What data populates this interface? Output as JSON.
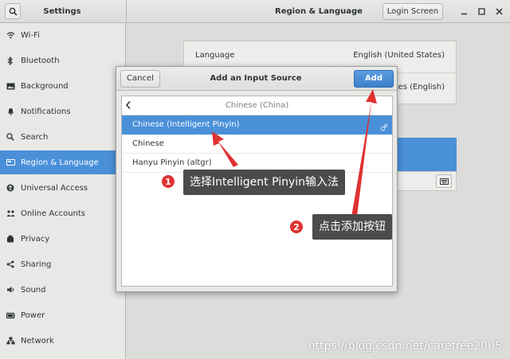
{
  "header": {
    "left_title": "Settings",
    "right_title": "Region & Language",
    "login_button": "Login Screen"
  },
  "sidebar": {
    "items": [
      {
        "label": "Wi-Fi",
        "icon": "wifi-icon"
      },
      {
        "label": "Bluetooth",
        "icon": "bluetooth-icon"
      },
      {
        "label": "Background",
        "icon": "background-icon"
      },
      {
        "label": "Notifications",
        "icon": "bell-icon"
      },
      {
        "label": "Search",
        "icon": "search-icon"
      },
      {
        "label": "Region & Language",
        "icon": "flag-icon",
        "active": true
      },
      {
        "label": "Universal Access",
        "icon": "accessibility-icon"
      },
      {
        "label": "Online Accounts",
        "icon": "accounts-icon"
      },
      {
        "label": "Privacy",
        "icon": "privacy-icon"
      },
      {
        "label": "Sharing",
        "icon": "share-icon"
      },
      {
        "label": "Sound",
        "icon": "speaker-icon"
      },
      {
        "label": "Power",
        "icon": "power-icon"
      },
      {
        "label": "Network",
        "icon": "network-icon"
      }
    ]
  },
  "main": {
    "language_label": "Language",
    "language_value": "English (United States)",
    "formats_value": "tates (English)"
  },
  "dialog": {
    "cancel": "Cancel",
    "title": "Add an Input Source",
    "add": "Add",
    "group": "Chinese (China)",
    "options": [
      "Chinese (Intelligent Pinyin)",
      "Chinese",
      "Hanyu Pinyin (altgr)"
    ]
  },
  "annotations": {
    "step1_num": "1",
    "step1_text": "选择Intelligent Pinyin输入法",
    "step2_num": "2",
    "step2_text": "点击添加按钮"
  },
  "watermark": "https://blog.csdn.net/carefree2005",
  "colors": {
    "accent": "#4a90d9",
    "badge": "#e03131",
    "arrow": "#e03131"
  }
}
